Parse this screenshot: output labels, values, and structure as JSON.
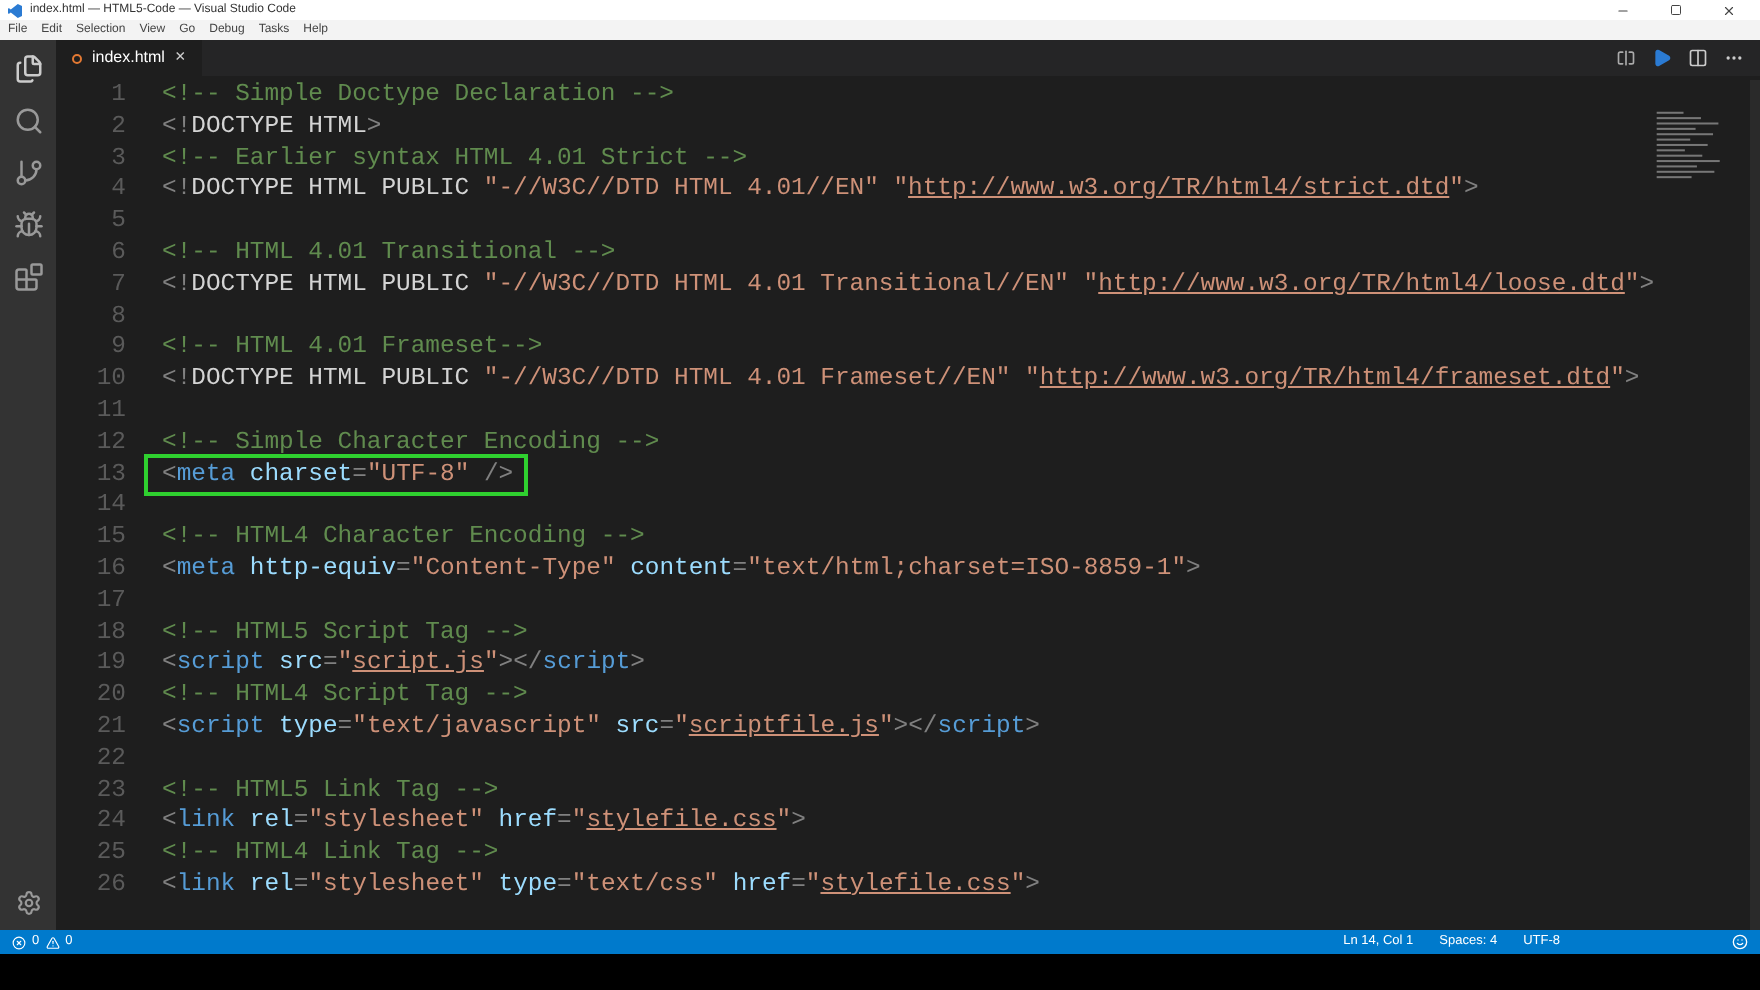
{
  "window": {
    "title": "index.html — HTML5-Code — Visual Studio Code"
  },
  "menu": [
    "File",
    "Edit",
    "Selection",
    "View",
    "Go",
    "Debug",
    "Tasks",
    "Help"
  ],
  "tabs": [
    {
      "label": "index.html",
      "selected": true
    }
  ],
  "close_glyph": "×",
  "editor": {
    "lines": [
      {
        "number": "1",
        "tokens": [
          {
            "kind": "comment",
            "text": "<!-- Simple Doctype Declaration -->"
          }
        ]
      },
      {
        "number": "2",
        "tokens": [
          {
            "kind": "punct",
            "text": "<!"
          },
          {
            "kind": "plain",
            "text": "DOCTYPE HTML"
          },
          {
            "kind": "punct",
            "text": ">"
          }
        ]
      },
      {
        "number": "3",
        "tokens": [
          {
            "kind": "comment",
            "text": "<!-- Earlier syntax HTML 4.01 Strict -->"
          }
        ]
      },
      {
        "number": "4",
        "tokens": [
          {
            "kind": "punct",
            "text": "<!"
          },
          {
            "kind": "plain",
            "text": "DOCTYPE HTML PUBLIC "
          },
          {
            "kind": "string",
            "text": "\"-//W3C//DTD HTML 4.01//EN\" \""
          },
          {
            "kind": "link",
            "text": "http://www.w3.org/TR/html4/strict.dtd"
          },
          {
            "kind": "string",
            "text": "\""
          },
          {
            "kind": "punct",
            "text": ">"
          }
        ]
      },
      {
        "number": "5"
      },
      {
        "number": "6",
        "tokens": [
          {
            "kind": "comment",
            "text": "<!-- HTML 4.01 Transitional -->"
          }
        ]
      },
      {
        "number": "7",
        "tokens": [
          {
            "kind": "punct",
            "text": "<!"
          },
          {
            "kind": "plain",
            "text": "DOCTYPE HTML PUBLIC "
          },
          {
            "kind": "string",
            "text": "\"-//W3C//DTD HTML 4.01 Transitional//EN\" \""
          },
          {
            "kind": "link",
            "text": "http://www.w3.org/TR/html4/loose.dtd"
          },
          {
            "kind": "string",
            "text": "\""
          },
          {
            "kind": "punct",
            "text": ">"
          }
        ]
      },
      {
        "number": "8"
      },
      {
        "number": "9",
        "tokens": [
          {
            "kind": "comment",
            "text": "<!-- HTML 4.01 Frameset-->"
          }
        ]
      },
      {
        "number": "10",
        "tokens": [
          {
            "kind": "punct",
            "text": "<!"
          },
          {
            "kind": "plain",
            "text": "DOCTYPE HTML PUBLIC "
          },
          {
            "kind": "string",
            "text": "\"-//W3C//DTD HTML 4.01 Frameset//EN\" \""
          },
          {
            "kind": "link",
            "text": "http://www.w3.org/TR/html4/frameset.dtd"
          },
          {
            "kind": "string",
            "text": "\""
          },
          {
            "kind": "punct",
            "text": ">"
          }
        ]
      },
      {
        "number": "11"
      },
      {
        "number": "12",
        "tokens": [
          {
            "kind": "comment",
            "text": "<!-- Simple Character Encoding -->"
          }
        ]
      },
      {
        "number": "13",
        "highlighted": true,
        "tokens": [
          {
            "kind": "punct",
            "text": "<"
          },
          {
            "kind": "tag",
            "text": "meta"
          },
          {
            "kind": "attr",
            "text": " charset"
          },
          {
            "kind": "punct",
            "text": "="
          },
          {
            "kind": "string",
            "text": "\"UTF-8\""
          },
          {
            "kind": "punct",
            "text": " />"
          }
        ]
      },
      {
        "number": "14"
      },
      {
        "number": "15",
        "tokens": [
          {
            "kind": "comment",
            "text": "<!-- HTML4 Character Encoding -->"
          }
        ]
      },
      {
        "number": "16",
        "tokens": [
          {
            "kind": "punct",
            "text": "<"
          },
          {
            "kind": "tag",
            "text": "meta"
          },
          {
            "kind": "attr",
            "text": " http-equiv"
          },
          {
            "kind": "punct",
            "text": "="
          },
          {
            "kind": "string",
            "text": "\"Content-Type\""
          },
          {
            "kind": "attr",
            "text": " content"
          },
          {
            "kind": "punct",
            "text": "="
          },
          {
            "kind": "string",
            "text": "\"text/html;charset=ISO-8859-1\""
          },
          {
            "kind": "punct",
            "text": ">"
          }
        ]
      },
      {
        "number": "17"
      },
      {
        "number": "18",
        "tokens": [
          {
            "kind": "comment",
            "text": "<!-- HTML5 Script Tag -->"
          }
        ]
      },
      {
        "number": "19",
        "tokens": [
          {
            "kind": "punct",
            "text": "<"
          },
          {
            "kind": "tag",
            "text": "script"
          },
          {
            "kind": "attr",
            "text": " src"
          },
          {
            "kind": "punct",
            "text": "="
          },
          {
            "kind": "string",
            "text": "\""
          },
          {
            "kind": "link",
            "text": "script.js"
          },
          {
            "kind": "string",
            "text": "\""
          },
          {
            "kind": "punct",
            "text": "></"
          },
          {
            "kind": "tag",
            "text": "script"
          },
          {
            "kind": "punct",
            "text": ">"
          }
        ]
      },
      {
        "number": "20",
        "tokens": [
          {
            "kind": "comment",
            "text": "<!-- HTML4 Script Tag -->"
          }
        ]
      },
      {
        "number": "21",
        "tokens": [
          {
            "kind": "punct",
            "text": "<"
          },
          {
            "kind": "tag",
            "text": "script"
          },
          {
            "kind": "attr",
            "text": " type"
          },
          {
            "kind": "punct",
            "text": "="
          },
          {
            "kind": "string",
            "text": "\"text/javascript\""
          },
          {
            "kind": "attr",
            "text": " src"
          },
          {
            "kind": "punct",
            "text": "="
          },
          {
            "kind": "string",
            "text": "\""
          },
          {
            "kind": "link",
            "text": "scriptfile.js"
          },
          {
            "kind": "string",
            "text": "\""
          },
          {
            "kind": "punct",
            "text": "></"
          },
          {
            "kind": "tag",
            "text": "script"
          },
          {
            "kind": "punct",
            "text": ">"
          }
        ]
      },
      {
        "number": "22"
      },
      {
        "number": "23",
        "tokens": [
          {
            "kind": "comment",
            "text": "<!-- HTML5 Link Tag -->"
          }
        ]
      },
      {
        "number": "24",
        "tokens": [
          {
            "kind": "punct",
            "text": "<"
          },
          {
            "kind": "tag",
            "text": "link"
          },
          {
            "kind": "attr",
            "text": " rel"
          },
          {
            "kind": "punct",
            "text": "="
          },
          {
            "kind": "string",
            "text": "\"stylesheet\""
          },
          {
            "kind": "attr",
            "text": " href"
          },
          {
            "kind": "punct",
            "text": "="
          },
          {
            "kind": "string",
            "text": "\""
          },
          {
            "kind": "link",
            "text": "stylefile.css"
          },
          {
            "kind": "string",
            "text": "\""
          },
          {
            "kind": "punct",
            "text": ">"
          }
        ]
      },
      {
        "number": "25",
        "tokens": [
          {
            "kind": "comment",
            "text": "<!-- HTML4 Link Tag -->"
          }
        ]
      },
      {
        "number": "26",
        "tokens": [
          {
            "kind": "punct",
            "text": "<"
          },
          {
            "kind": "tag",
            "text": "link"
          },
          {
            "kind": "attr",
            "text": " rel"
          },
          {
            "kind": "punct",
            "text": "="
          },
          {
            "kind": "string",
            "text": "\"stylesheet\""
          },
          {
            "kind": "attr",
            "text": " type"
          },
          {
            "kind": "punct",
            "text": "="
          },
          {
            "kind": "string",
            "text": "\"text/css\""
          },
          {
            "kind": "attr",
            "text": " href"
          },
          {
            "kind": "punct",
            "text": "="
          },
          {
            "kind": "string",
            "text": "\""
          },
          {
            "kind": "link",
            "text": "stylefile.css"
          },
          {
            "kind": "string",
            "text": "\""
          },
          {
            "kind": "punct",
            "text": ">"
          }
        ]
      }
    ]
  },
  "status_bar": {
    "errors": "0",
    "warnings": "0",
    "items": [
      "Ln 14, Col 1",
      "Spaces: 4",
      "UTF-8"
    ]
  }
}
